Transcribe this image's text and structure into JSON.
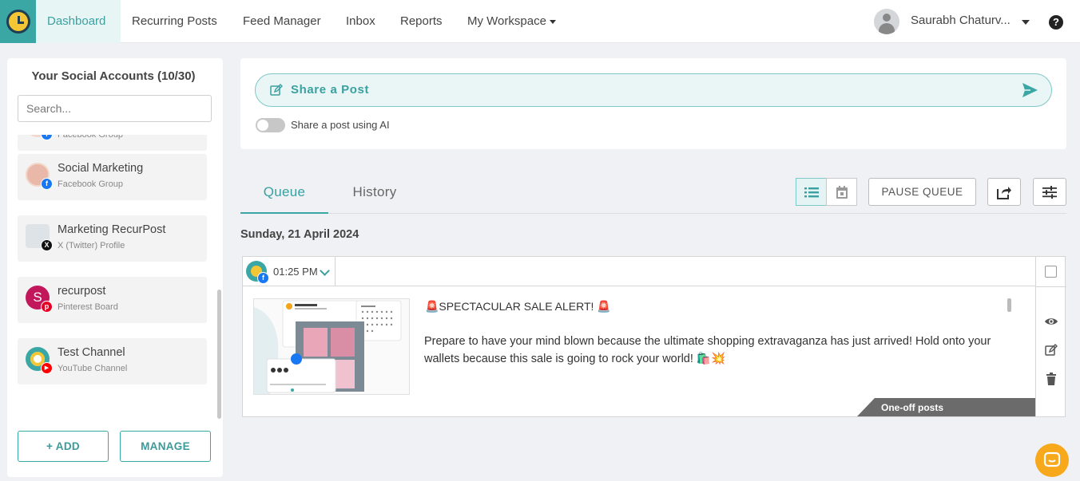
{
  "nav": {
    "items": [
      "Dashboard",
      "Recurring Posts",
      "Feed Manager",
      "Inbox",
      "Reports",
      "My Workspace"
    ],
    "user_name": "Saurabh Chaturv...",
    "help_label": "?"
  },
  "sidebar": {
    "title": "Your Social Accounts (10/30)",
    "search_placeholder": "Search...",
    "accounts": [
      {
        "name": "",
        "type": "Facebook Group",
        "badge": "f"
      },
      {
        "name": "Social Marketing",
        "type": "Facebook Group",
        "badge": "f"
      },
      {
        "name": "Marketing RecurPost",
        "type": "X (Twitter) Profile",
        "badge": "X"
      },
      {
        "name": "recurpost",
        "type": "Pinterest Board",
        "badge": "p",
        "initial": "S"
      },
      {
        "name": "Test Channel",
        "type": "YouTube Channel",
        "badge": "▶"
      }
    ],
    "add_label": "+ ADD",
    "manage_label": "MANAGE"
  },
  "share": {
    "label": "Share a Post",
    "ai_toggle_label": "Share a post using AI"
  },
  "tabs": {
    "queue": "Queue",
    "history": "History",
    "pause_label": "PAUSE QUEUE"
  },
  "queue": {
    "date_heading": "Sunday, 21 April 2024",
    "post": {
      "time": "01:25 PM",
      "title": "🚨SPECTACULAR SALE ALERT! 🚨",
      "body": "Prepare to have your mind blown because the ultimate shopping extravaganza has just arrived! Hold onto your wallets because this sale is going to rock your world! 🛍️💥",
      "tag": "One-off posts"
    }
  },
  "colors": {
    "accent": "#3aa7a5",
    "logo_yellow": "#f4c534",
    "facebook": "#1877f2",
    "pinterest": "#e60023",
    "youtube": "#ff0000",
    "chat": "#f7a81b"
  }
}
